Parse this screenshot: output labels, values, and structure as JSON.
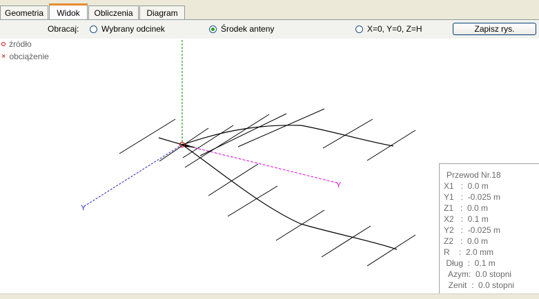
{
  "tabs": [
    {
      "label": "Geometria",
      "active": false
    },
    {
      "label": "Widok",
      "active": true
    },
    {
      "label": "Obliczenia",
      "active": false
    },
    {
      "label": "Diagram",
      "active": false
    }
  ],
  "toolbar": {
    "rotate_label": "Obracaj:",
    "options": [
      {
        "label": "Wybrany odcinek",
        "selected": false
      },
      {
        "label": "Środek anteny",
        "selected": true
      },
      {
        "label": "X=0, Y=0, Z=H",
        "selected": false
      }
    ],
    "save_button": "Zapisz rys."
  },
  "legend": {
    "source": "źródło",
    "load": "obciążenie"
  },
  "info": {
    "title": "Przewod Nr.18",
    "rows": [
      "X1   :  0.0 m",
      "Y1   :  -0.025 m",
      "Z1   :  0.0 m",
      "X2   :  0.1 m",
      "Y2   :  -0.025 m",
      "Z2   :  0.0 m",
      "R    :  2.0 mm",
      " Dług  :  0.1 m",
      "  Azym:  0.0 stopni",
      "  Zenit  :  0.0 stopni"
    ]
  },
  "colors": {
    "accent_tab": "#e68b2c",
    "radio_dot": "#21a121",
    "x_axis": "#2020c0",
    "y_axis": "#d000d0",
    "z_axis": "#008000",
    "source_marker": "#d00000"
  }
}
